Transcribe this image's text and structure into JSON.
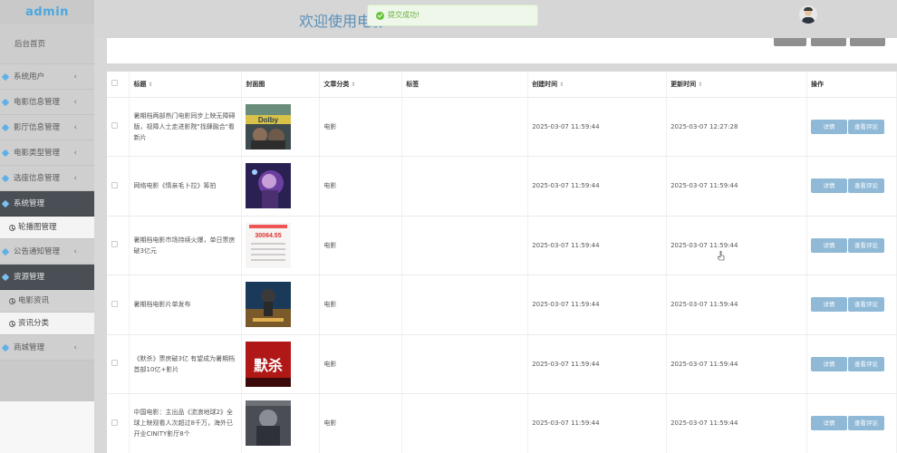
{
  "brand": "admin",
  "header": {
    "welcome": "欢迎使用电影"
  },
  "toast": {
    "message": "提交成功!"
  },
  "sidebar": {
    "home": "后台首页",
    "items": [
      {
        "label": "系统用户"
      },
      {
        "label": "电影信息管理"
      },
      {
        "label": "影厅信息管理"
      },
      {
        "label": "电影类型管理"
      },
      {
        "label": "选座信息管理"
      },
      {
        "label": "系统管理"
      },
      {
        "label": "轮播图管理"
      },
      {
        "label": "公告通知管理"
      },
      {
        "label": "资源管理"
      },
      {
        "label": "电影资讯"
      },
      {
        "label": "资讯分类"
      },
      {
        "label": "商城管理"
      }
    ]
  },
  "table": {
    "columns": [
      "标题",
      "封面图",
      "文章分类",
      "标签",
      "创建时间",
      "更新时间",
      "操作"
    ],
    "buttons": {
      "detail": "详情",
      "comments": "查看评论"
    },
    "rows": [
      {
        "title": "暑期档两部热门电影同步上映无障碍版，视障人士走进影院\"找肆融合\"看新片",
        "category": "电影",
        "tag": "",
        "created": "2025-03-07 11:59:44",
        "updated": "2025-03-07 12:27:28",
        "cover_text": "Dolby"
      },
      {
        "title": "网络电影《情亲毛卜拉》筹拍",
        "category": "电影",
        "tag": "",
        "created": "2025-03-07 11:59:44",
        "updated": "2025-03-07 11:59:44",
        "cover_text": ""
      },
      {
        "title": "暑期档电影市场持续火爆，单日票房破3亿元",
        "category": "电影",
        "tag": "",
        "created": "2025-03-07 11:59:44",
        "updated": "2025-03-07 11:59:44",
        "cover_text": "30064.55"
      },
      {
        "title": "暑期档电影片单发布",
        "category": "电影",
        "tag": "",
        "created": "2025-03-07 11:59:44",
        "updated": "2025-03-07 11:59:44",
        "cover_text": ""
      },
      {
        "title": "《默杀》票房破3亿 有望成为暑期档首部10亿+影片",
        "category": "电影",
        "tag": "",
        "created": "2025-03-07 11:59:44",
        "updated": "2025-03-07 11:59:44",
        "cover_text": "默杀"
      },
      {
        "title": "中国电影：主出品《流浪地球2》全球上映观看人次超过8千万，海外已开业CINITY影厅8个",
        "category": "电影",
        "tag": "",
        "created": "2025-03-07 11:59:44",
        "updated": "2025-03-07 11:59:44",
        "cover_text": ""
      }
    ]
  },
  "colors": {
    "accent": "#4aa8e0",
    "button": "#8fb9d6",
    "sidebar_dark": "#4a4f55",
    "success": "#67c23a"
  }
}
